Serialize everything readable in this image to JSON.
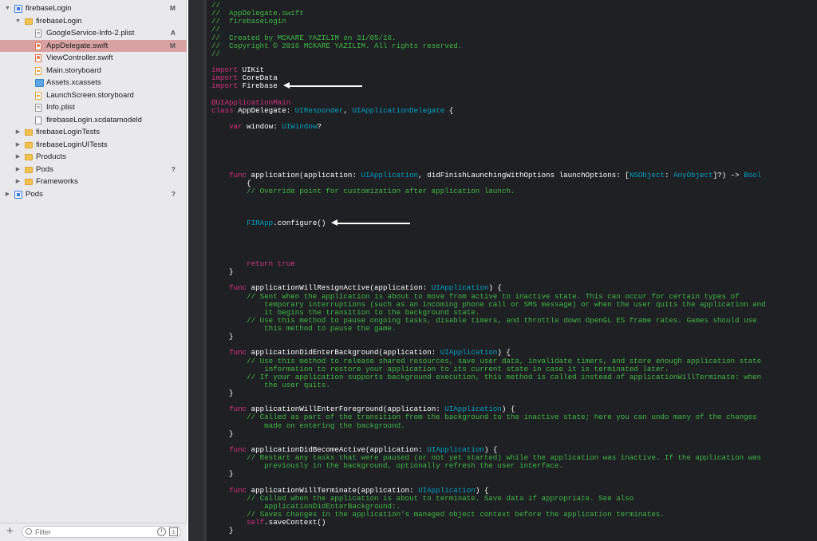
{
  "navigator": {
    "items": [
      {
        "label": "firebaseLogin",
        "badge": "M",
        "icon": "project",
        "indent": 0,
        "disclosure": "▼",
        "selected": false
      },
      {
        "label": "firebaseLogin",
        "badge": "",
        "icon": "folder",
        "indent": 1,
        "disclosure": "▼",
        "selected": false
      },
      {
        "label": "GoogleService-Info-2.plist",
        "badge": "A",
        "icon": "plist",
        "indent": 2,
        "disclosure": "",
        "selected": false
      },
      {
        "label": "AppDelegate.swift",
        "badge": "M",
        "icon": "swift",
        "indent": 2,
        "disclosure": "",
        "selected": true
      },
      {
        "label": "ViewController.swift",
        "badge": "",
        "icon": "swift",
        "indent": 2,
        "disclosure": "",
        "selected": false
      },
      {
        "label": "Main.storyboard",
        "badge": "",
        "icon": "storyboard",
        "indent": 2,
        "disclosure": "",
        "selected": false
      },
      {
        "label": "Assets.xcassets",
        "badge": "",
        "icon": "assets",
        "indent": 2,
        "disclosure": "",
        "selected": false
      },
      {
        "label": "LaunchScreen.storyboard",
        "badge": "",
        "icon": "storyboard",
        "indent": 2,
        "disclosure": "",
        "selected": false
      },
      {
        "label": "Info.plist",
        "badge": "",
        "icon": "plist",
        "indent": 2,
        "disclosure": "",
        "selected": false
      },
      {
        "label": "firebaseLogin.xcdatamodeld",
        "badge": "",
        "icon": "model",
        "indent": 2,
        "disclosure": "",
        "selected": false
      },
      {
        "label": "firebaseLoginTests",
        "badge": "",
        "icon": "folder",
        "indent": 1,
        "disclosure": "▶",
        "selected": false
      },
      {
        "label": "firebaseLoginUITests",
        "badge": "",
        "icon": "folder",
        "indent": 1,
        "disclosure": "▶",
        "selected": false
      },
      {
        "label": "Products",
        "badge": "",
        "icon": "folder",
        "indent": 1,
        "disclosure": "▶",
        "selected": false
      },
      {
        "label": "Pods",
        "badge": "?",
        "icon": "folder",
        "indent": 1,
        "disclosure": "▶",
        "selected": false
      },
      {
        "label": "Frameworks",
        "badge": "",
        "icon": "folder",
        "indent": 1,
        "disclosure": "▶",
        "selected": false
      },
      {
        "label": "Pods",
        "badge": "?",
        "icon": "project",
        "indent": 0,
        "disclosure": "▶",
        "selected": false
      }
    ],
    "filter": {
      "placeholder": "Filter",
      "add_label": "+"
    }
  },
  "editor": {
    "lines": [
      [
        [
          "c",
          "//"
        ]
      ],
      [
        [
          "c",
          "//  AppDelegate.swift"
        ]
      ],
      [
        [
          "c",
          "//  firebaseLogin"
        ]
      ],
      [
        [
          "c",
          "//"
        ]
      ],
      [
        [
          "c",
          "//  Created by MCKARE YAZILIM on 31/05/16."
        ]
      ],
      [
        [
          "c",
          "//  Copyright © 2016 MCKARE YAZILIM. All rights reserved."
        ]
      ],
      [
        [
          "c",
          "//"
        ]
      ],
      [],
      [
        [
          "k",
          "import"
        ],
        [
          "p",
          " UIKit"
        ]
      ],
      [
        [
          "k",
          "import"
        ],
        [
          "p",
          " CoreData"
        ]
      ],
      [
        [
          "k",
          "import"
        ],
        [
          "p",
          " Firebase"
        ]
      ],
      [],
      [
        [
          "a",
          "@UIApplicationMain"
        ]
      ],
      [
        [
          "k",
          "class"
        ],
        [
          "p",
          " AppDelegate: "
        ],
        [
          "t",
          "UIResponder"
        ],
        [
          "p",
          ", "
        ],
        [
          "t",
          "UIApplicationDelegate"
        ],
        [
          "p",
          " {"
        ]
      ],
      [],
      [
        [
          "p",
          "    "
        ],
        [
          "k",
          "var"
        ],
        [
          "p",
          " window: "
        ],
        [
          "t",
          "UIWindow"
        ],
        [
          "p",
          "?"
        ]
      ],
      [],
      [],
      [],
      [],
      [],
      [
        [
          "p",
          "    "
        ],
        [
          "k",
          "func"
        ],
        [
          "p",
          " application(application: "
        ],
        [
          "t",
          "UIApplication"
        ],
        [
          "p",
          ", didFinishLaunchingWithOptions launchOptions: ["
        ],
        [
          "t",
          "NSObject"
        ],
        [
          "p",
          ": "
        ],
        [
          "t",
          "AnyObject"
        ],
        [
          "p",
          "]?) -> "
        ],
        [
          "t",
          "Bool"
        ]
      ],
      [
        [
          "p",
          "        {"
        ]
      ],
      [
        [
          "p",
          "        "
        ],
        [
          "c",
          "// Override point for customization after application launch."
        ]
      ],
      [],
      [],
      [],
      [
        [
          "p",
          "        "
        ],
        [
          "t",
          "FIRApp"
        ],
        [
          "p",
          ".configure()"
        ]
      ],
      [],
      [],
      [],
      [],
      [
        [
          "p",
          "        "
        ],
        [
          "k",
          "return"
        ],
        [
          "p",
          " "
        ],
        [
          "k",
          "true"
        ]
      ],
      [
        [
          "p",
          "    }"
        ]
      ],
      [],
      [
        [
          "p",
          "    "
        ],
        [
          "k",
          "func"
        ],
        [
          "p",
          " applicationWillResignActive(application: "
        ],
        [
          "t",
          "UIApplication"
        ],
        [
          "p",
          ") {"
        ]
      ],
      [
        [
          "p",
          "        "
        ],
        [
          "c",
          "// Sent when the application is about to move from active to inactive state. This can occur for certain types of"
        ]
      ],
      [
        [
          "c",
          "            temporary interruptions (such as an incoming phone call or SMS message) or when the user quits the application and"
        ]
      ],
      [
        [
          "c",
          "            it begins the transition to the background state."
        ]
      ],
      [
        [
          "p",
          "        "
        ],
        [
          "c",
          "// Use this method to pause ongoing tasks, disable timers, and throttle down OpenGL ES frame rates. Games should use"
        ]
      ],
      [
        [
          "c",
          "            this method to pause the game."
        ]
      ],
      [
        [
          "p",
          "    }"
        ]
      ],
      [],
      [
        [
          "p",
          "    "
        ],
        [
          "k",
          "func"
        ],
        [
          "p",
          " applicationDidEnterBackground(application: "
        ],
        [
          "t",
          "UIApplication"
        ],
        [
          "p",
          ") {"
        ]
      ],
      [
        [
          "p",
          "        "
        ],
        [
          "c",
          "// Use this method to release shared resources, save user data, invalidate timers, and store enough application state"
        ]
      ],
      [
        [
          "c",
          "            information to restore your application to its current state in case it is terminated later."
        ]
      ],
      [
        [
          "p",
          "        "
        ],
        [
          "c",
          "// If your application supports background execution, this method is called instead of applicationWillTerminate: when"
        ]
      ],
      [
        [
          "c",
          "            the user quits."
        ]
      ],
      [
        [
          "p",
          "    }"
        ]
      ],
      [],
      [
        [
          "p",
          "    "
        ],
        [
          "k",
          "func"
        ],
        [
          "p",
          " applicationWillEnterForeground(application: "
        ],
        [
          "t",
          "UIApplication"
        ],
        [
          "p",
          ") {"
        ]
      ],
      [
        [
          "p",
          "        "
        ],
        [
          "c",
          "// Called as part of the transition from the background to the inactive state; here you can undo many of the changes"
        ]
      ],
      [
        [
          "c",
          "            made on entering the background."
        ]
      ],
      [
        [
          "p",
          "    }"
        ]
      ],
      [],
      [
        [
          "p",
          "    "
        ],
        [
          "k",
          "func"
        ],
        [
          "p",
          " applicationDidBecomeActive(application: "
        ],
        [
          "t",
          "UIApplication"
        ],
        [
          "p",
          ") {"
        ]
      ],
      [
        [
          "p",
          "        "
        ],
        [
          "c",
          "// Restart any tasks that were paused (or not yet started) while the application was inactive. If the application was"
        ]
      ],
      [
        [
          "c",
          "            previously in the background, optionally refresh the user interface."
        ]
      ],
      [
        [
          "p",
          "    }"
        ]
      ],
      [],
      [
        [
          "p",
          "    "
        ],
        [
          "k",
          "func"
        ],
        [
          "p",
          " applicationWillTerminate(application: "
        ],
        [
          "t",
          "UIApplication"
        ],
        [
          "p",
          ") {"
        ]
      ],
      [
        [
          "p",
          "        "
        ],
        [
          "c",
          "// Called when the application is about to terminate. Save data if appropriate. See also"
        ]
      ],
      [
        [
          "c",
          "            applicationDidEnterBackground:."
        ]
      ],
      [
        [
          "p",
          "        "
        ],
        [
          "c",
          "// Saves changes in the application's managed object context before the application terminates."
        ]
      ],
      [
        [
          "p",
          "        "
        ],
        [
          "k",
          "self"
        ],
        [
          "p",
          ".saveContext()"
        ]
      ],
      [
        [
          "p",
          "    }"
        ]
      ]
    ],
    "arrow_annotations": [
      {
        "line": 10,
        "target": "import-firebase"
      },
      {
        "line": 27,
        "target": "firapp-configure"
      }
    ]
  },
  "colors": {
    "editor_background": "#1f2024",
    "comment": "#41b645",
    "keyword": "#d2337e",
    "type": "#00a0be",
    "plain": "#ffffff",
    "selection": "#d8a2a3",
    "sidebar_background": "#e9e9eb"
  }
}
